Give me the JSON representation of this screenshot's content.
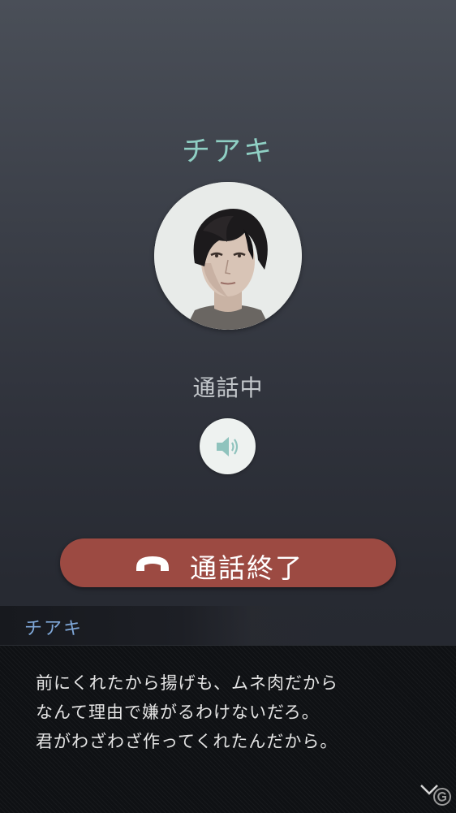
{
  "call": {
    "caller_name": "チアキ",
    "status": "通話中",
    "end_call_label": "通話終了"
  },
  "icons": {
    "avatar": "character-portrait",
    "speaker": "speaker-volume-icon",
    "end_call": "phone-hangup-icon",
    "next": "chevron-down-icon"
  },
  "dialogue": {
    "speaker": "チアキ",
    "lines": [
      "前にくれたから揚げも、ムネ肉だから",
      "なんて理由で嫌がるわけないだろ。",
      "君がわざわざ作ってくれたんだから。"
    ]
  },
  "colors": {
    "accent": "#8fd0c4",
    "end_call": "#9c4a42",
    "speaker_name": "#7fa8d9"
  }
}
